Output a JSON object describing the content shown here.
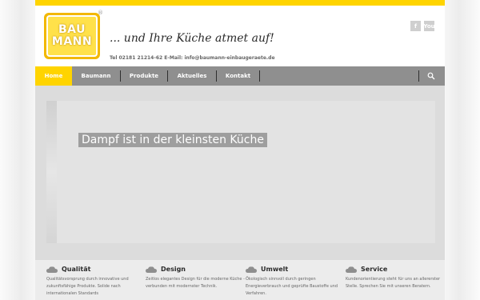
{
  "brand": {
    "logo_line1": "BAU",
    "logo_line2": "MANN",
    "reg": "®",
    "tagline": "... und Ihre Küche atmet auf!",
    "contact": "Tel 02181 21214-62 E-Mail: info@baumann-einbaugeraete.de"
  },
  "social": {
    "facebook": "f",
    "youtube": "You"
  },
  "nav": {
    "items": [
      {
        "label": "Home",
        "active": true
      },
      {
        "label": "Baumann",
        "active": false
      },
      {
        "label": "Produkte",
        "active": false
      },
      {
        "label": "Aktuelles",
        "active": false
      },
      {
        "label": "Kontakt",
        "active": false
      }
    ],
    "search_icon": "search-icon"
  },
  "hero": {
    "title": "Dampf ist in der kleinsten Küche"
  },
  "features": [
    {
      "title": "Qualität",
      "text": "Qualitätsvorsprung durch innovative und zukunftsfähige Produkte. Solide nach internationalen Standards"
    },
    {
      "title": "Design",
      "text": "Zeitlos elegantes Design für die moderne Küche - verbunden mit modernster Technik."
    },
    {
      "title": "Umwelt",
      "text": "Ökologisch sinnvoll durch geringen Energieverbrauch und geprüfte Baustoffe und Verfahren."
    },
    {
      "title": "Service",
      "text": "Kundenorientierung steht für uns an allererster Stelle. Sprechen Sie mit unseren Beratern."
    }
  ],
  "colors": {
    "accent": "#ffd400",
    "nav": "#8f8f8f"
  }
}
